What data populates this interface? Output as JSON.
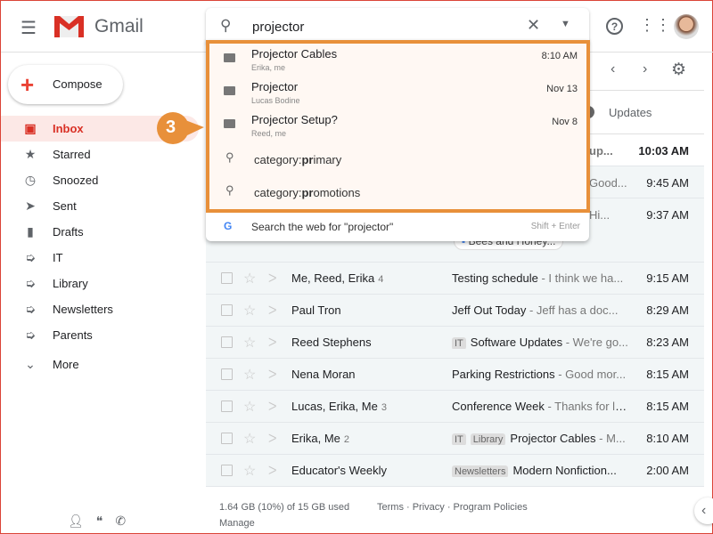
{
  "header": {
    "app_name": "Gmail",
    "search_value": "projector"
  },
  "sidebar": {
    "compose": "Compose",
    "items": [
      {
        "label": "Inbox",
        "icon": "inbox-icon",
        "glyph": "▣",
        "active": true
      },
      {
        "label": "Starred",
        "icon": "star-icon",
        "glyph": "★"
      },
      {
        "label": "Snoozed",
        "icon": "clock-icon",
        "glyph": "◷"
      },
      {
        "label": "Sent",
        "icon": "send-icon",
        "glyph": "➤"
      },
      {
        "label": "Drafts",
        "icon": "draft-icon",
        "glyph": "▮"
      },
      {
        "label": "IT",
        "icon": "label-icon",
        "glyph": "➭"
      },
      {
        "label": "Library",
        "icon": "label-icon",
        "glyph": "➭"
      },
      {
        "label": "Newsletters",
        "icon": "label-icon",
        "glyph": "➭"
      },
      {
        "label": "Parents",
        "icon": "label-icon",
        "glyph": "➭"
      }
    ],
    "more": "More"
  },
  "tabs": {
    "updates": "Updates"
  },
  "callout": {
    "number": "3",
    "color": "#e8903a"
  },
  "suggestions": {
    "emails": [
      {
        "title": "Projector Cables",
        "sub": "Erika, me",
        "date": "8:10 AM"
      },
      {
        "title": "Projector",
        "sub": "Lucas Bodine",
        "date": "Nov 13"
      },
      {
        "title": "Projector Setup?",
        "sub": "Reed, me",
        "date": "Nov 8"
      }
    ],
    "queries": [
      {
        "pre": "category:",
        "bold": "pr",
        "post": "imary"
      },
      {
        "pre": "category:",
        "bold": "pr",
        "post": "omotions"
      }
    ],
    "web": {
      "label": "Search the web for \"projector\"",
      "shortcut": "Shift + Enter"
    }
  },
  "hidden_rows": [
    {
      "snip": "up...",
      "time": "10:03 AM"
    },
    {
      "snip": "Good...",
      "time": "9:45 AM"
    },
    {
      "snip": "Hi...",
      "time": "9:37 AM",
      "attachment": "Bees and Honey..."
    }
  ],
  "rows": [
    {
      "sender": "Me, Reed, Erika",
      "count": "4",
      "labels": [],
      "subject": "Testing schedule",
      "snippet": " - I think we ha...",
      "time": "9:15 AM"
    },
    {
      "sender": "Paul Tron",
      "count": "",
      "labels": [],
      "subject": "Jeff Out Today ",
      "snippet": " - Jeff has a doc...",
      "time": "8:29 AM"
    },
    {
      "sender": "Reed Stephens",
      "count": "",
      "labels": [
        "IT"
      ],
      "subject": "Software Updates",
      "snippet": " - We're go...",
      "time": "8:23 AM"
    },
    {
      "sender": "Nena Moran",
      "count": "",
      "labels": [],
      "subject": "Parking Restrictions",
      "snippet": " - Good mor...",
      "time": "8:15 AM"
    },
    {
      "sender": "Lucas, Erika, Me",
      "count": "3",
      "labels": [],
      "subject": "Conference Week",
      "snippet": " - Thanks for le...",
      "time": "8:15 AM"
    },
    {
      "sender": "Erika, Me",
      "count": "2",
      "labels": [
        "IT",
        "Library"
      ],
      "subject": "Projector Cables",
      "snippet": " - M...",
      "time": "8:10 AM"
    },
    {
      "sender": "Educator's Weekly",
      "count": "",
      "labels": [
        "Newsletters"
      ],
      "subject": "Modern Nonfiction...",
      "snippet": "",
      "time": "2:00 AM"
    }
  ],
  "footer": {
    "storage": "1.64 GB (10%) of 15 GB used",
    "manage": "Manage",
    "links": "Terms · Privacy · Program Policies"
  }
}
